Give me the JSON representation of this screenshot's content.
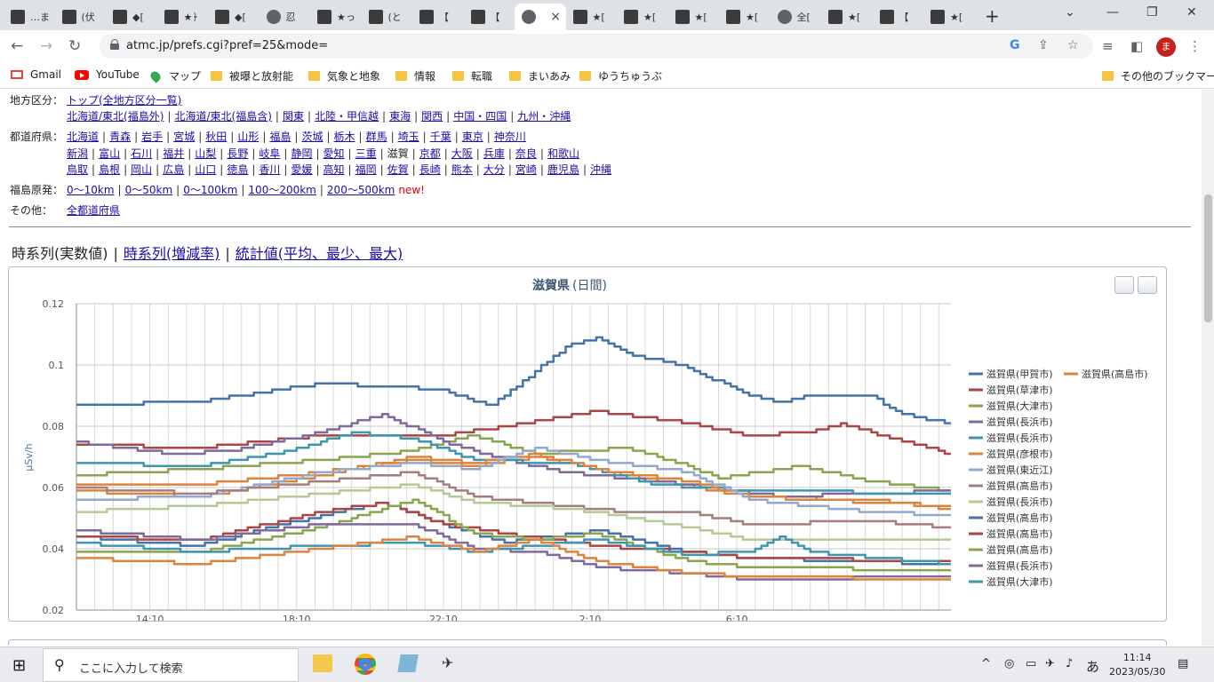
{
  "browser": {
    "tabs": [
      {
        "label": "…ま",
        "favicon": "site-icon"
      },
      {
        "label": "(伏",
        "favicon": "site-icon"
      },
      {
        "label": "◆[",
        "favicon": "site-icon"
      },
      {
        "label": "★﴿",
        "favicon": "site-icon"
      },
      {
        "label": "◆[",
        "favicon": "site-icon"
      },
      {
        "label": "忍",
        "favicon": "globe-icon"
      },
      {
        "label": "★っ",
        "favicon": "site-icon"
      },
      {
        "label": "(と",
        "favicon": "site-icon"
      },
      {
        "label": "【",
        "favicon": "site-icon"
      },
      {
        "label": "【",
        "favicon": "site-icon"
      },
      {
        "label": "",
        "favicon": "globe-icon",
        "active": true
      },
      {
        "label": "★[",
        "favicon": "site-icon"
      },
      {
        "label": "★[",
        "favicon": "site-icon"
      },
      {
        "label": "★[",
        "favicon": "site-icon"
      },
      {
        "label": "★[",
        "favicon": "site-icon"
      },
      {
        "label": "全[",
        "favicon": "globe-icon"
      },
      {
        "label": "★[",
        "favicon": "site-icon"
      },
      {
        "label": "【",
        "favicon": "site-icon"
      },
      {
        "label": "★[",
        "favicon": "site-icon"
      }
    ],
    "close_tab": "×",
    "new_tab": "+",
    "url": "atmc.jp/prefs.cgi?pref=25&mode=",
    "profile_initial": "ま",
    "bookmarks": [
      {
        "label": "Gmail",
        "icon": "gmail-icon"
      },
      {
        "label": "YouTube",
        "icon": "youtube-icon"
      },
      {
        "label": "マップ",
        "icon": "maps-icon"
      },
      {
        "label": "被曝と放射能",
        "icon": "folder-icon"
      },
      {
        "label": "気象と地象",
        "icon": "folder-icon"
      },
      {
        "label": "情報",
        "icon": "folder-icon"
      },
      {
        "label": "転職",
        "icon": "folder-icon"
      },
      {
        "label": "まいあみ",
        "icon": "folder-icon"
      },
      {
        "label": "ゆうちゅうぶ",
        "icon": "folder-icon"
      }
    ],
    "other_bookmarks": "その他のブックマーク"
  },
  "nav": {
    "region_label": "地方区分：",
    "region_top": "トップ(全地方区分一覧)",
    "regions": [
      "北海道/東北(福島外)",
      "北海道/東北(福島含)",
      "関東",
      "北陸・甲信越",
      "東海",
      "関西",
      "中国・四国",
      "九州・沖縄"
    ],
    "pref_label": "都道府県：",
    "prefs_row1": [
      "北海道",
      "青森",
      "岩手",
      "宮城",
      "秋田",
      "山形",
      "福島",
      "茨城",
      "栃木",
      "群馬",
      "埼玉",
      "千葉",
      "東京",
      "神奈川"
    ],
    "prefs_row2": [
      "新潟",
      "富山",
      "石川",
      "福井",
      "山梨",
      "長野",
      "岐阜",
      "静岡",
      "愛知",
      "三重",
      "滋賀",
      "京都",
      "大阪",
      "兵庫",
      "奈良",
      "和歌山"
    ],
    "prefs_row3": [
      "鳥取",
      "島根",
      "岡山",
      "広島",
      "山口",
      "徳島",
      "香川",
      "愛媛",
      "高知",
      "福岡",
      "佐賀",
      "長崎",
      "熊本",
      "大分",
      "宮崎",
      "鹿児島",
      "沖縄"
    ],
    "fukushima_label": "福島原発：",
    "fukushima": [
      "0〜10km",
      "0〜50km",
      "0〜100km",
      "100〜200km",
      "200〜500km"
    ],
    "new_badge": "new!",
    "other_label": "その他：",
    "other": "全都道府県"
  },
  "view_tabs": {
    "current": "時系列(実数値)",
    "sep": "|",
    "rate": "時系列(増減率)",
    "stats": "統計値(平均、最少、最大)"
  },
  "chart_data": {
    "type": "line",
    "title": "滋賀県",
    "subtitle": "(日間)",
    "ylabel": "μSv/h",
    "ylim": [
      0.02,
      0.12
    ],
    "yticks": [
      "0.02",
      "0.04",
      "0.06",
      "0.08",
      "0.1",
      "0.12"
    ],
    "xticks": [
      {
        "label": "14:10",
        "i": 12
      },
      {
        "label": "18:10",
        "i": 36
      },
      {
        "label": "22:10",
        "i": 60
      },
      {
        "label": "2:10",
        "i": 84
      },
      {
        "label": "6:10",
        "i": 108
      }
    ],
    "n_points": 144,
    "grid": true,
    "legend_position": "right",
    "series": [
      {
        "name": "滋賀県(甲賀市)",
        "color": "#4572a7",
        "keys": [
          [
            0,
            0.087
          ],
          [
            20,
            0.088
          ],
          [
            40,
            0.094
          ],
          [
            60,
            0.092
          ],
          [
            65,
            0.088
          ],
          [
            68,
            0.087
          ],
          [
            75,
            0.098
          ],
          [
            80,
            0.106
          ],
          [
            85,
            0.109
          ],
          [
            90,
            0.104
          ],
          [
            100,
            0.099
          ],
          [
            110,
            0.09
          ],
          [
            115,
            0.088
          ],
          [
            120,
            0.09
          ],
          [
            130,
            0.09
          ],
          [
            133,
            0.086
          ],
          [
            137,
            0.083
          ],
          [
            143,
            0.081
          ]
        ]
      },
      {
        "name": "滋賀県(高島市)",
        "color": "#db843d",
        "keys": [
          [
            0,
            0.061
          ],
          [
            20,
            0.061
          ],
          [
            40,
            0.065
          ],
          [
            55,
            0.069
          ],
          [
            65,
            0.067
          ],
          [
            75,
            0.07
          ],
          [
            90,
            0.064
          ],
          [
            110,
            0.057
          ],
          [
            130,
            0.056
          ],
          [
            143,
            0.053
          ]
        ]
      },
      {
        "name": "滋賀県(草津市)",
        "color": "#aa4643",
        "keys": [
          [
            0,
            0.074
          ],
          [
            20,
            0.073
          ],
          [
            40,
            0.077
          ],
          [
            60,
            0.077
          ],
          [
            70,
            0.08
          ],
          [
            85,
            0.085
          ],
          [
            100,
            0.081
          ],
          [
            110,
            0.077
          ],
          [
            120,
            0.078
          ],
          [
            125,
            0.081
          ],
          [
            135,
            0.075
          ],
          [
            143,
            0.071
          ]
        ]
      },
      {
        "name": "滋賀県(大津市)",
        "color": "#89a54e",
        "keys": [
          [
            0,
            0.064
          ],
          [
            20,
            0.066
          ],
          [
            40,
            0.069
          ],
          [
            55,
            0.072
          ],
          [
            65,
            0.077
          ],
          [
            75,
            0.071
          ],
          [
            90,
            0.073
          ],
          [
            100,
            0.067
          ],
          [
            105,
            0.063
          ],
          [
            118,
            0.067
          ],
          [
            130,
            0.062
          ],
          [
            143,
            0.059
          ]
        ]
      },
      {
        "name": "滋賀県(長浜市)",
        "color": "#80699b",
        "keys": [
          [
            0,
            0.075
          ],
          [
            15,
            0.071
          ],
          [
            25,
            0.072
          ],
          [
            40,
            0.078
          ],
          [
            50,
            0.084
          ],
          [
            60,
            0.075
          ],
          [
            70,
            0.069
          ],
          [
            80,
            0.065
          ],
          [
            90,
            0.063
          ],
          [
            100,
            0.061
          ],
          [
            115,
            0.057
          ],
          [
            143,
            0.059
          ]
        ]
      },
      {
        "name": "滋賀県(長浜市)",
        "color": "#3d96ae",
        "keys": [
          [
            0,
            0.068
          ],
          [
            20,
            0.067
          ],
          [
            35,
            0.072
          ],
          [
            45,
            0.078
          ],
          [
            55,
            0.076
          ],
          [
            65,
            0.069
          ],
          [
            80,
            0.068
          ],
          [
            95,
            0.061
          ],
          [
            110,
            0.059
          ],
          [
            143,
            0.058
          ]
        ]
      },
      {
        "name": "滋賀県(彦根市)",
        "color": "#db843d",
        "keys": [
          [
            0,
            0.059
          ],
          [
            20,
            0.057
          ],
          [
            40,
            0.064
          ],
          [
            55,
            0.07
          ],
          [
            65,
            0.068
          ],
          [
            75,
            0.071
          ],
          [
            85,
            0.066
          ],
          [
            100,
            0.062
          ],
          [
            110,
            0.057
          ],
          [
            143,
            0.054
          ]
        ]
      },
      {
        "name": "滋賀県(東近江)",
        "color": "#92a8cd",
        "keys": [
          [
            0,
            0.056
          ],
          [
            20,
            0.057
          ],
          [
            40,
            0.065
          ],
          [
            55,
            0.068
          ],
          [
            65,
            0.066
          ],
          [
            75,
            0.073
          ],
          [
            85,
            0.069
          ],
          [
            100,
            0.065
          ],
          [
            110,
            0.056
          ],
          [
            130,
            0.052
          ],
          [
            143,
            0.051
          ]
        ]
      },
      {
        "name": "滋賀県(高島市)",
        "color": "#a47d7c",
        "keys": [
          [
            0,
            0.06
          ],
          [
            20,
            0.058
          ],
          [
            40,
            0.062
          ],
          [
            55,
            0.065
          ],
          [
            65,
            0.057
          ],
          [
            75,
            0.055
          ],
          [
            90,
            0.052
          ],
          [
            100,
            0.052
          ],
          [
            110,
            0.048
          ],
          [
            130,
            0.049
          ],
          [
            143,
            0.047
          ]
        ]
      },
      {
        "name": "滋賀県(長浜市)",
        "color": "#b5ca92",
        "keys": [
          [
            0,
            0.052
          ],
          [
            20,
            0.054
          ],
          [
            40,
            0.058
          ],
          [
            55,
            0.061
          ],
          [
            65,
            0.055
          ],
          [
            75,
            0.054
          ],
          [
            85,
            0.052
          ],
          [
            100,
            0.047
          ],
          [
            110,
            0.043
          ],
          [
            143,
            0.043
          ]
        ]
      },
      {
        "name": "滋賀県(高島市)",
        "color": "#4572a7",
        "keys": [
          [
            0,
            0.044
          ],
          [
            20,
            0.041
          ],
          [
            40,
            0.051
          ],
          [
            50,
            0.055
          ],
          [
            60,
            0.048
          ],
          [
            70,
            0.042
          ],
          [
            85,
            0.046
          ],
          [
            100,
            0.039
          ],
          [
            110,
            0.037
          ],
          [
            143,
            0.035
          ]
        ]
      },
      {
        "name": "滋賀県(高島市)",
        "color": "#aa4643",
        "keys": [
          [
            0,
            0.044
          ],
          [
            20,
            0.043
          ],
          [
            40,
            0.052
          ],
          [
            50,
            0.055
          ],
          [
            60,
            0.048
          ],
          [
            70,
            0.045
          ],
          [
            85,
            0.041
          ],
          [
            100,
            0.039
          ],
          [
            110,
            0.037
          ],
          [
            143,
            0.036
          ]
        ]
      },
      {
        "name": "滋賀県(高島市)",
        "color": "#89a54e",
        "keys": [
          [
            0,
            0.039
          ],
          [
            20,
            0.039
          ],
          [
            40,
            0.047
          ],
          [
            55,
            0.056
          ],
          [
            65,
            0.045
          ],
          [
            75,
            0.043
          ],
          [
            85,
            0.045
          ],
          [
            100,
            0.036
          ],
          [
            110,
            0.034
          ],
          [
            143,
            0.033
          ]
        ]
      },
      {
        "name": "滋賀県(長浜市)",
        "color": "#80699b",
        "keys": [
          [
            0,
            0.046
          ],
          [
            20,
            0.043
          ],
          [
            40,
            0.048
          ],
          [
            55,
            0.048
          ],
          [
            65,
            0.04
          ],
          [
            75,
            0.039
          ],
          [
            85,
            0.034
          ],
          [
            100,
            0.032
          ],
          [
            110,
            0.03
          ],
          [
            143,
            0.031
          ]
        ]
      },
      {
        "name": "滋賀県(大津市)",
        "color": "#3d96ae",
        "keys": [
          [
            0,
            0.042
          ],
          [
            20,
            0.039
          ],
          [
            40,
            0.041
          ],
          [
            55,
            0.042
          ],
          [
            65,
            0.039
          ],
          [
            75,
            0.041
          ],
          [
            85,
            0.043
          ],
          [
            100,
            0.038
          ],
          [
            110,
            0.039
          ],
          [
            115,
            0.044
          ],
          [
            120,
            0.039
          ],
          [
            143,
            0.035
          ]
        ]
      },
      {
        "name": "",
        "color": "#db843d",
        "keys": [
          [
            0,
            0.037
          ],
          [
            20,
            0.035
          ],
          [
            40,
            0.04
          ],
          [
            55,
            0.044
          ],
          [
            65,
            0.039
          ],
          [
            75,
            0.043
          ],
          [
            85,
            0.036
          ],
          [
            100,
            0.032
          ],
          [
            110,
            0.031
          ],
          [
            143,
            0.03
          ]
        ]
      }
    ]
  },
  "taskbar": {
    "search_placeholder": "ここに入力して検索",
    "ime": "あ",
    "time": "11:14",
    "date": "2023/05/30"
  }
}
